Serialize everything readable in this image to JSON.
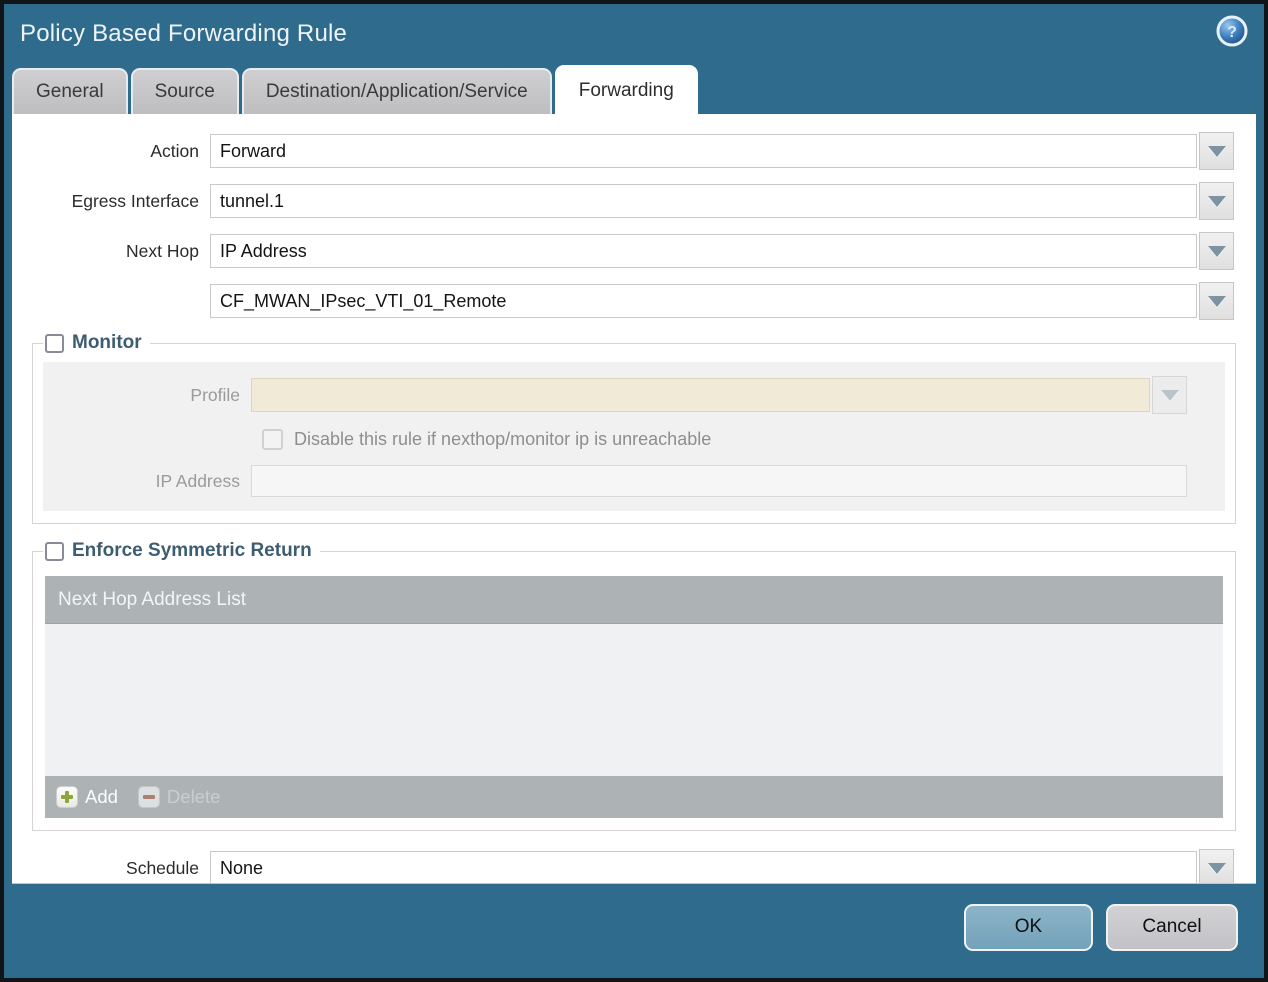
{
  "dialog": {
    "title": "Policy Based Forwarding Rule"
  },
  "tabs": [
    {
      "label": "General",
      "active": false
    },
    {
      "label": "Source",
      "active": false
    },
    {
      "label": "Destination/Application/Service",
      "active": false
    },
    {
      "label": "Forwarding",
      "active": true
    }
  ],
  "form": {
    "action": {
      "label": "Action",
      "value": "Forward"
    },
    "egress_interface": {
      "label": "Egress Interface",
      "value": "tunnel.1"
    },
    "next_hop": {
      "label": "Next Hop",
      "value": "IP Address"
    },
    "next_hop_address": {
      "value": "CF_MWAN_IPsec_VTI_01_Remote"
    },
    "schedule": {
      "label": "Schedule",
      "value": "None"
    }
  },
  "monitor": {
    "legend": "Monitor",
    "checked": false,
    "profile": {
      "label": "Profile",
      "value": ""
    },
    "disable_rule_checkbox": {
      "label": "Disable this rule if nexthop/monitor ip is unreachable",
      "checked": false
    },
    "ip_address": {
      "label": "IP Address",
      "value": ""
    }
  },
  "symmetric_return": {
    "legend": "Enforce Symmetric Return",
    "checked": false,
    "table_header": "Next Hop Address List",
    "add_label": "Add",
    "delete_label": "Delete",
    "delete_enabled": false,
    "rows": []
  },
  "footer": {
    "ok_label": "OK",
    "cancel_label": "Cancel"
  },
  "colors": {
    "header_teal": "#2f6b8c",
    "legend_text": "#3d5e72",
    "table_gray": "#adb2b5",
    "ok_button": "#7ba9c0",
    "cancel_button": "#c9c9cd",
    "add_plus_green": "#8ea43d",
    "delete_minus_red": "#ad7e73",
    "profile_disabled_bg": "#f0ead7"
  }
}
